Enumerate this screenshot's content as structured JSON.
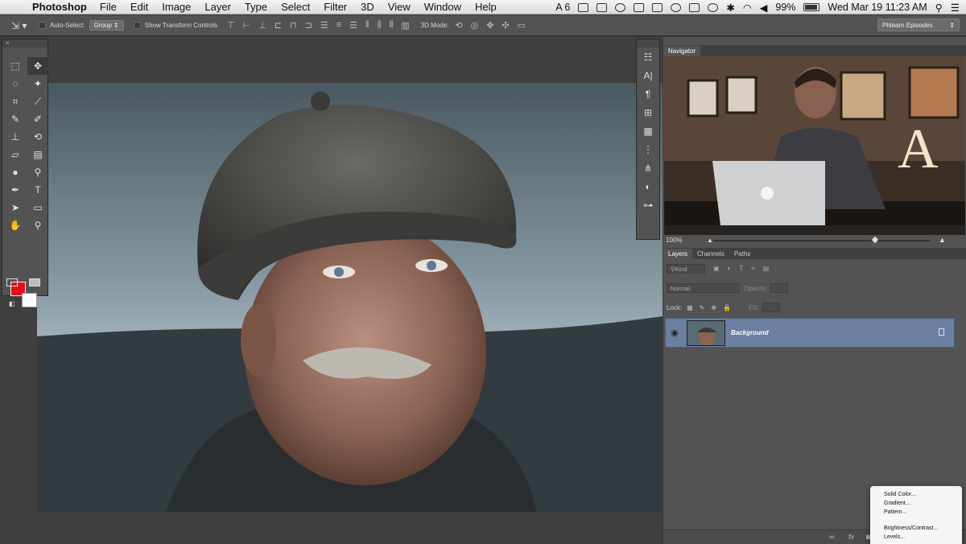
{
  "menubar": {
    "app": "Photoshop",
    "items": [
      "File",
      "Edit",
      "Image",
      "Layer",
      "Type",
      "Select",
      "Filter",
      "3D",
      "View",
      "Window",
      "Help"
    ],
    "status_num": "6",
    "battery": "99%",
    "clock": "Wed Mar 19  11:23 AM"
  },
  "options": {
    "auto_select": "Auto-Select:",
    "group_value": "Group",
    "show_transform": "Show Transform Controls",
    "mode_3d": "3D Mode:",
    "workspace": "Phlearn Episodes"
  },
  "navigator": {
    "title": "Navigator",
    "zoom": "100%"
  },
  "layers": {
    "tabs": [
      "Layers",
      "Channels",
      "Paths"
    ],
    "kind_filter": "Kind",
    "blend_mode": "Normal",
    "opacity_label": "Opacity:",
    "lock_label": "Lock:",
    "fill_label": "Fill:",
    "layer_name": "Background"
  },
  "adjustment_menu": {
    "items": [
      "Solid Color...",
      "Gradient...",
      "Pattern...",
      "",
      "Brightness/Contrast...",
      "Levels..."
    ]
  },
  "colors": {
    "foreground": "#e0101a",
    "background": "#ffffff",
    "selected_layer": "#6b7fa0"
  }
}
